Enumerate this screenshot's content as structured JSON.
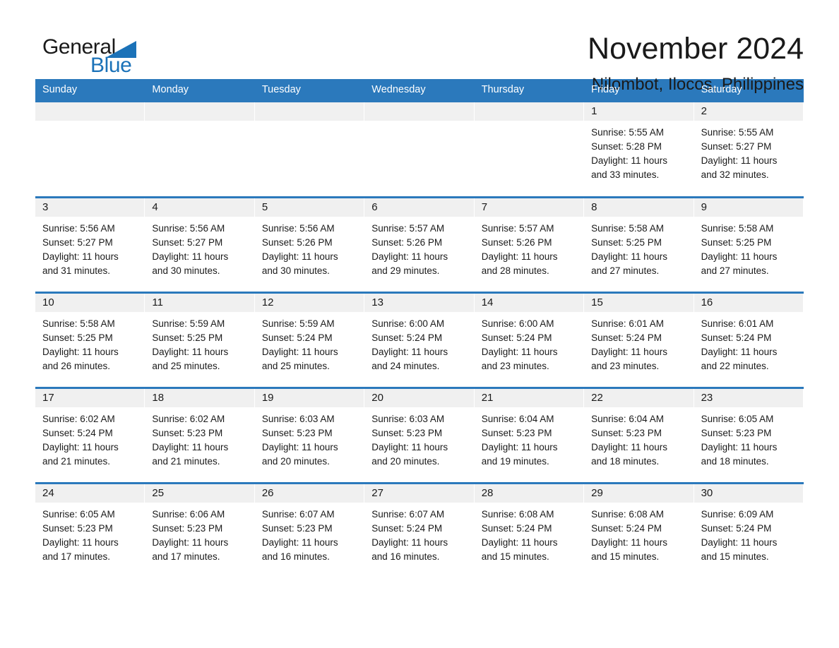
{
  "brand": {
    "name_part1": "General",
    "name_part2": "Blue"
  },
  "header": {
    "month_title": "November 2024",
    "location": "Nilombot, Ilocos, Philippines"
  },
  "colors": {
    "header_blue": "#2b79bc",
    "brand_blue": "#1b72b8",
    "day_band_gray": "#f0f0f0"
  },
  "weekdays": [
    "Sunday",
    "Monday",
    "Tuesday",
    "Wednesday",
    "Thursday",
    "Friday",
    "Saturday"
  ],
  "weeks": [
    [
      {
        "empty": true
      },
      {
        "empty": true
      },
      {
        "empty": true
      },
      {
        "empty": true
      },
      {
        "empty": true
      },
      {
        "day": "1",
        "sunrise": "Sunrise: 5:55 AM",
        "sunset": "Sunset: 5:28 PM",
        "daylight_line1": "Daylight: 11 hours",
        "daylight_line2": "and 33 minutes."
      },
      {
        "day": "2",
        "sunrise": "Sunrise: 5:55 AM",
        "sunset": "Sunset: 5:27 PM",
        "daylight_line1": "Daylight: 11 hours",
        "daylight_line2": "and 32 minutes."
      }
    ],
    [
      {
        "day": "3",
        "sunrise": "Sunrise: 5:56 AM",
        "sunset": "Sunset: 5:27 PM",
        "daylight_line1": "Daylight: 11 hours",
        "daylight_line2": "and 31 minutes."
      },
      {
        "day": "4",
        "sunrise": "Sunrise: 5:56 AM",
        "sunset": "Sunset: 5:27 PM",
        "daylight_line1": "Daylight: 11 hours",
        "daylight_line2": "and 30 minutes."
      },
      {
        "day": "5",
        "sunrise": "Sunrise: 5:56 AM",
        "sunset": "Sunset: 5:26 PM",
        "daylight_line1": "Daylight: 11 hours",
        "daylight_line2": "and 30 minutes."
      },
      {
        "day": "6",
        "sunrise": "Sunrise: 5:57 AM",
        "sunset": "Sunset: 5:26 PM",
        "daylight_line1": "Daylight: 11 hours",
        "daylight_line2": "and 29 minutes."
      },
      {
        "day": "7",
        "sunrise": "Sunrise: 5:57 AM",
        "sunset": "Sunset: 5:26 PM",
        "daylight_line1": "Daylight: 11 hours",
        "daylight_line2": "and 28 minutes."
      },
      {
        "day": "8",
        "sunrise": "Sunrise: 5:58 AM",
        "sunset": "Sunset: 5:25 PM",
        "daylight_line1": "Daylight: 11 hours",
        "daylight_line2": "and 27 minutes."
      },
      {
        "day": "9",
        "sunrise": "Sunrise: 5:58 AM",
        "sunset": "Sunset: 5:25 PM",
        "daylight_line1": "Daylight: 11 hours",
        "daylight_line2": "and 27 minutes."
      }
    ],
    [
      {
        "day": "10",
        "sunrise": "Sunrise: 5:58 AM",
        "sunset": "Sunset: 5:25 PM",
        "daylight_line1": "Daylight: 11 hours",
        "daylight_line2": "and 26 minutes."
      },
      {
        "day": "11",
        "sunrise": "Sunrise: 5:59 AM",
        "sunset": "Sunset: 5:25 PM",
        "daylight_line1": "Daylight: 11 hours",
        "daylight_line2": "and 25 minutes."
      },
      {
        "day": "12",
        "sunrise": "Sunrise: 5:59 AM",
        "sunset": "Sunset: 5:24 PM",
        "daylight_line1": "Daylight: 11 hours",
        "daylight_line2": "and 25 minutes."
      },
      {
        "day": "13",
        "sunrise": "Sunrise: 6:00 AM",
        "sunset": "Sunset: 5:24 PM",
        "daylight_line1": "Daylight: 11 hours",
        "daylight_line2": "and 24 minutes."
      },
      {
        "day": "14",
        "sunrise": "Sunrise: 6:00 AM",
        "sunset": "Sunset: 5:24 PM",
        "daylight_line1": "Daylight: 11 hours",
        "daylight_line2": "and 23 minutes."
      },
      {
        "day": "15",
        "sunrise": "Sunrise: 6:01 AM",
        "sunset": "Sunset: 5:24 PM",
        "daylight_line1": "Daylight: 11 hours",
        "daylight_line2": "and 23 minutes."
      },
      {
        "day": "16",
        "sunrise": "Sunrise: 6:01 AM",
        "sunset": "Sunset: 5:24 PM",
        "daylight_line1": "Daylight: 11 hours",
        "daylight_line2": "and 22 minutes."
      }
    ],
    [
      {
        "day": "17",
        "sunrise": "Sunrise: 6:02 AM",
        "sunset": "Sunset: 5:24 PM",
        "daylight_line1": "Daylight: 11 hours",
        "daylight_line2": "and 21 minutes."
      },
      {
        "day": "18",
        "sunrise": "Sunrise: 6:02 AM",
        "sunset": "Sunset: 5:23 PM",
        "daylight_line1": "Daylight: 11 hours",
        "daylight_line2": "and 21 minutes."
      },
      {
        "day": "19",
        "sunrise": "Sunrise: 6:03 AM",
        "sunset": "Sunset: 5:23 PM",
        "daylight_line1": "Daylight: 11 hours",
        "daylight_line2": "and 20 minutes."
      },
      {
        "day": "20",
        "sunrise": "Sunrise: 6:03 AM",
        "sunset": "Sunset: 5:23 PM",
        "daylight_line1": "Daylight: 11 hours",
        "daylight_line2": "and 20 minutes."
      },
      {
        "day": "21",
        "sunrise": "Sunrise: 6:04 AM",
        "sunset": "Sunset: 5:23 PM",
        "daylight_line1": "Daylight: 11 hours",
        "daylight_line2": "and 19 minutes."
      },
      {
        "day": "22",
        "sunrise": "Sunrise: 6:04 AM",
        "sunset": "Sunset: 5:23 PM",
        "daylight_line1": "Daylight: 11 hours",
        "daylight_line2": "and 18 minutes."
      },
      {
        "day": "23",
        "sunrise": "Sunrise: 6:05 AM",
        "sunset": "Sunset: 5:23 PM",
        "daylight_line1": "Daylight: 11 hours",
        "daylight_line2": "and 18 minutes."
      }
    ],
    [
      {
        "day": "24",
        "sunrise": "Sunrise: 6:05 AM",
        "sunset": "Sunset: 5:23 PM",
        "daylight_line1": "Daylight: 11 hours",
        "daylight_line2": "and 17 minutes."
      },
      {
        "day": "25",
        "sunrise": "Sunrise: 6:06 AM",
        "sunset": "Sunset: 5:23 PM",
        "daylight_line1": "Daylight: 11 hours",
        "daylight_line2": "and 17 minutes."
      },
      {
        "day": "26",
        "sunrise": "Sunrise: 6:07 AM",
        "sunset": "Sunset: 5:23 PM",
        "daylight_line1": "Daylight: 11 hours",
        "daylight_line2": "and 16 minutes."
      },
      {
        "day": "27",
        "sunrise": "Sunrise: 6:07 AM",
        "sunset": "Sunset: 5:24 PM",
        "daylight_line1": "Daylight: 11 hours",
        "daylight_line2": "and 16 minutes."
      },
      {
        "day": "28",
        "sunrise": "Sunrise: 6:08 AM",
        "sunset": "Sunset: 5:24 PM",
        "daylight_line1": "Daylight: 11 hours",
        "daylight_line2": "and 15 minutes."
      },
      {
        "day": "29",
        "sunrise": "Sunrise: 6:08 AM",
        "sunset": "Sunset: 5:24 PM",
        "daylight_line1": "Daylight: 11 hours",
        "daylight_line2": "and 15 minutes."
      },
      {
        "day": "30",
        "sunrise": "Sunrise: 6:09 AM",
        "sunset": "Sunset: 5:24 PM",
        "daylight_line1": "Daylight: 11 hours",
        "daylight_line2": "and 15 minutes."
      }
    ]
  ]
}
